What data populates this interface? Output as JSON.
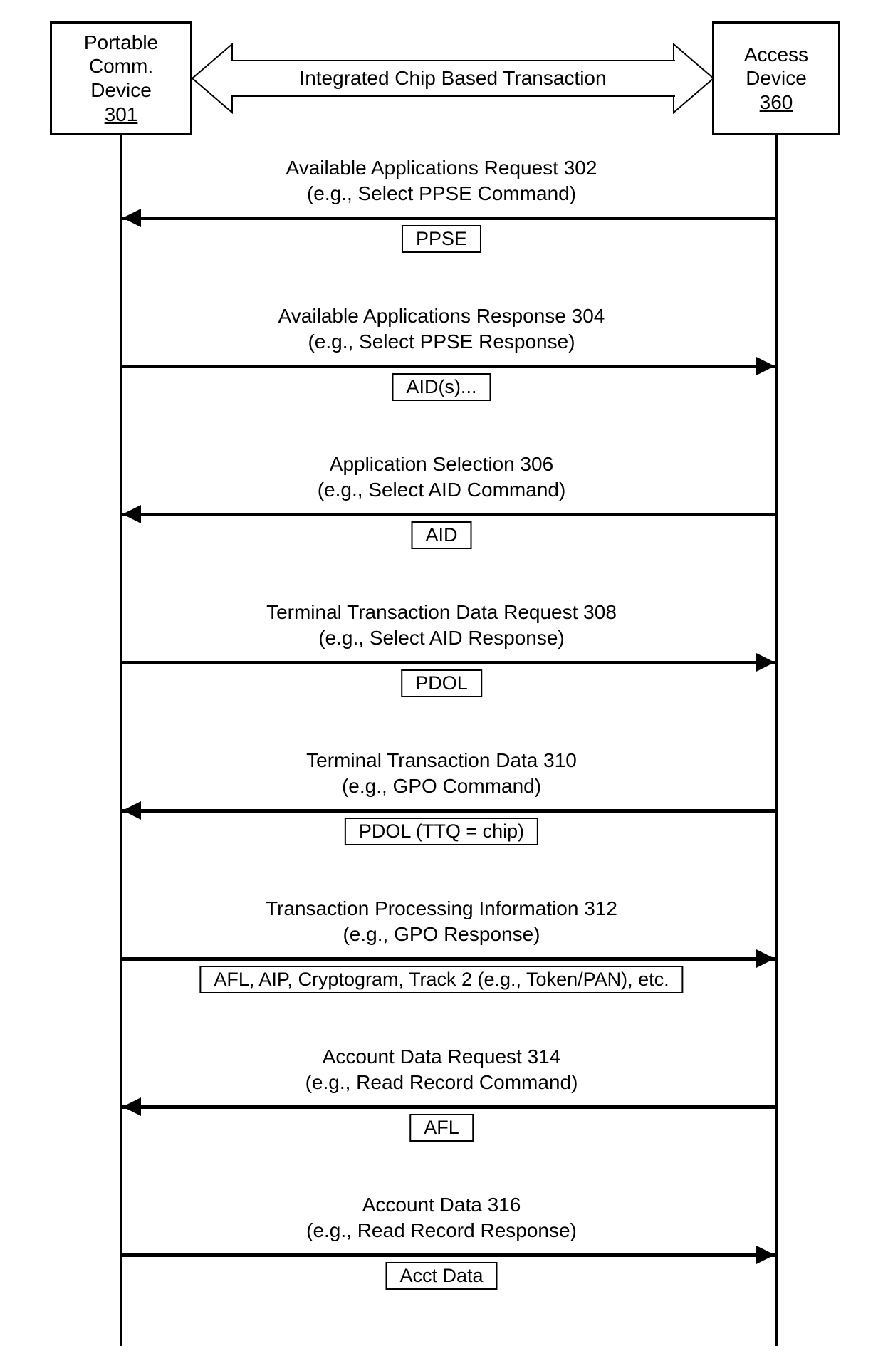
{
  "left_box": {
    "line1": "Portable",
    "line2": "Comm.",
    "line3": "Device",
    "num": "301"
  },
  "right_box": {
    "line1": "Access",
    "line2": "Device",
    "num": "360"
  },
  "big_arrow_label": "Integrated Chip Based Transaction",
  "messages": [
    {
      "title": "Available Applications Request 302",
      "sub": "(e.g., Select PPSE Command)",
      "dir": "left",
      "data": "PPSE"
    },
    {
      "title": "Available Applications Response 304",
      "sub": "(e.g., Select PPSE Response)",
      "dir": "right",
      "data": "AID(s)..."
    },
    {
      "title": "Application Selection 306",
      "sub": "(e.g., Select AID Command)",
      "dir": "left",
      "data": "AID"
    },
    {
      "title": "Terminal Transaction Data Request 308",
      "sub": "(e.g.,  Select AID Response)",
      "dir": "right",
      "data": "PDOL"
    },
    {
      "title": "Terminal Transaction Data 310",
      "sub": "(e.g., GPO Command)",
      "dir": "left",
      "data": "PDOL (TTQ = chip)"
    },
    {
      "title": "Transaction Processing Information 312",
      "sub": "(e.g., GPO Response)",
      "dir": "right",
      "data": "AFL, AIP, Cryptogram, Track 2 (e.g., Token/PAN), etc.",
      "wide": true
    },
    {
      "title": "Account Data Request 314",
      "sub": "(e.g., Read Record Command)",
      "dir": "left",
      "data": "AFL"
    },
    {
      "title": "Account Data 316",
      "sub": "(e.g., Read Record Response)",
      "dir": "right",
      "data": "Acct Data"
    }
  ]
}
